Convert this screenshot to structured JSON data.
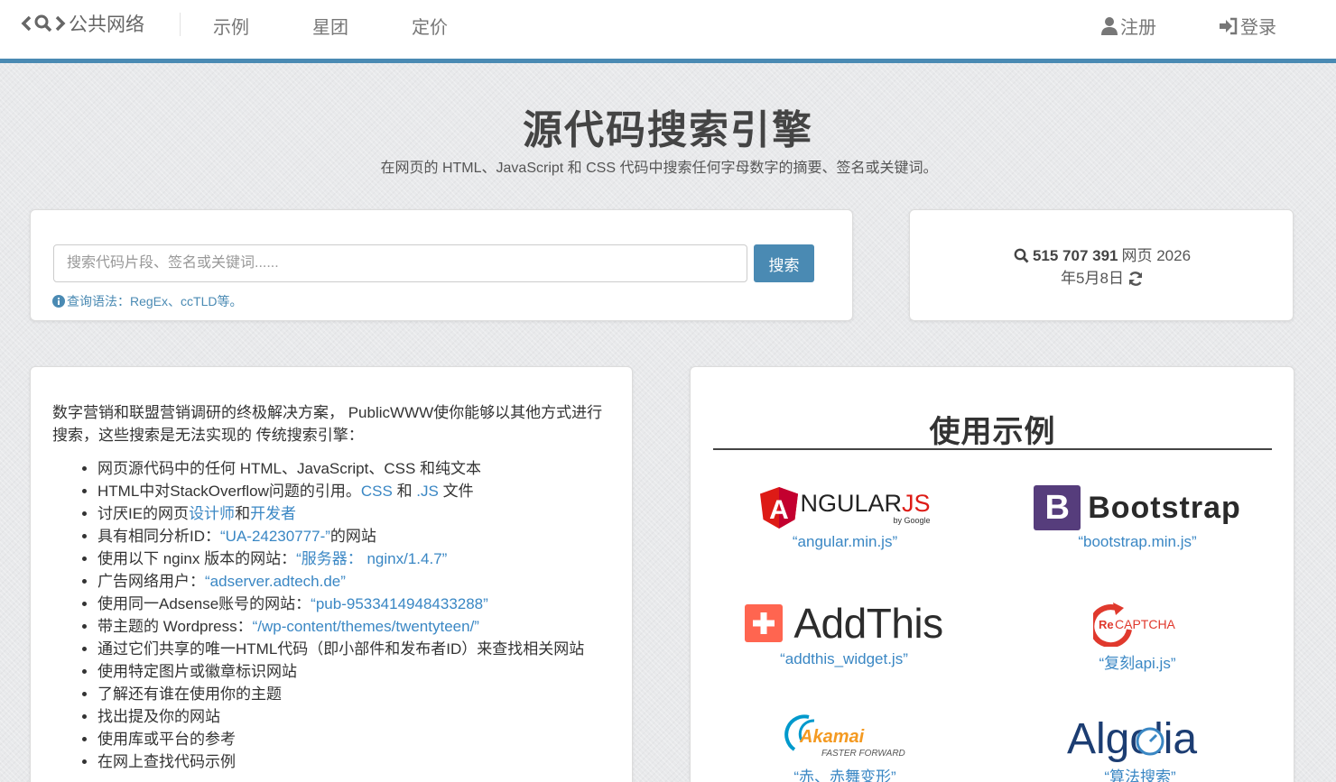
{
  "nav": {
    "brand": "公共网络",
    "items": [
      "示例",
      "星团",
      "定价"
    ],
    "register": "注册",
    "login": "登录"
  },
  "hero": {
    "title": "源代码搜索引擎",
    "subtitle": "在网页的 HTML、JavaScript 和 CSS 代码中搜索任何字母数字的摘要、签名或关键词。"
  },
  "search": {
    "placeholder": "搜索代码片段、签名或关键词......",
    "button": "搜索",
    "hint": "查询语法：RegEx、ccTLD等。"
  },
  "stats": {
    "count": "515 707 391",
    "unit": "网页 2026",
    "date": "年5月8日"
  },
  "intro": {
    "paragraph": "数字营销和联盟营销调研的终极解决方案， PublicWWW使你能够以其他方式进行搜索，这些搜索是无法实现的 传统搜索引擎：",
    "items": [
      {
        "text": "网页源代码中的任何 HTML、JavaScript、CSS 和纯文本"
      },
      {
        "pre": "HTML中对StackOverflow问题的引用。",
        "l1": "CSS",
        "mid": " 和 ",
        "l2": ".JS",
        "post": " 文件"
      },
      {
        "pre": "讨厌IE的网页",
        "l1": "设计师",
        "mid": "和",
        "l2": "开发者"
      },
      {
        "pre": "具有相同分析ID：",
        "l1": "“UA-24230777-”",
        "post": "的网站"
      },
      {
        "pre": "使用以下 nginx 版本的网站：",
        "l1": "“服务器： nginx/1.4.7”"
      },
      {
        "pre": "广告网络用户：",
        "l1": "“adserver.adtech.de”"
      },
      {
        "pre": "使用同一Adsense账号的网站：",
        "l1": "“pub-9533414948433288”"
      },
      {
        "pre": "带主题的 Wordpress：",
        "l1": "“/wp-content/themes/twentyteen/”"
      },
      {
        "text": "通过它们共享的唯一HTML代码（即小部件和发布者ID）来查找相关网站"
      },
      {
        "text": "使用特定图片或徽章标识网站"
      },
      {
        "text": "了解还有谁在使用你的主题"
      },
      {
        "text": "找出提及你的网站"
      },
      {
        "text": "使用库或平台的参考"
      },
      {
        "text": "在网上查找代码示例"
      }
    ]
  },
  "examples": {
    "title": "使用示例",
    "angular": {
      "logo_a": "A",
      "logo_text": "NGULAR",
      "logo_js": "JS",
      "by": "by Google",
      "caption": "“angular.min.js”"
    },
    "bootstrap": {
      "logo_b": "B",
      "logo_text": "Bootstrap",
      "caption": "“bootstrap.min.js”"
    },
    "addthis": {
      "logo_text": "AddThis",
      "caption": "“addthis_widget.js”"
    },
    "recaptcha": {
      "logo_re": "Re",
      "logo_text": "CAPTCHA",
      "caption": "“复刻api.js”"
    },
    "akamai": {
      "logo_text": "Akamai",
      "tagline": "FASTER FORWARD",
      "caption": "“赤、赤舞变形”"
    },
    "algolia": {
      "logo_text": "Algolia",
      "caption": "“算法搜索”"
    }
  },
  "colors": {
    "accent": "#4a8ab3",
    "link": "#3a87c4",
    "angular_red": "#dd1b16",
    "bootstrap_purple": "#563d7c",
    "addthis_orange": "#ff6550",
    "recaptcha_red": "#e0392d",
    "akamai_blue": "#0099cc",
    "akamai_orange": "#f49a22",
    "algolia_blue": "#1c3d72"
  }
}
